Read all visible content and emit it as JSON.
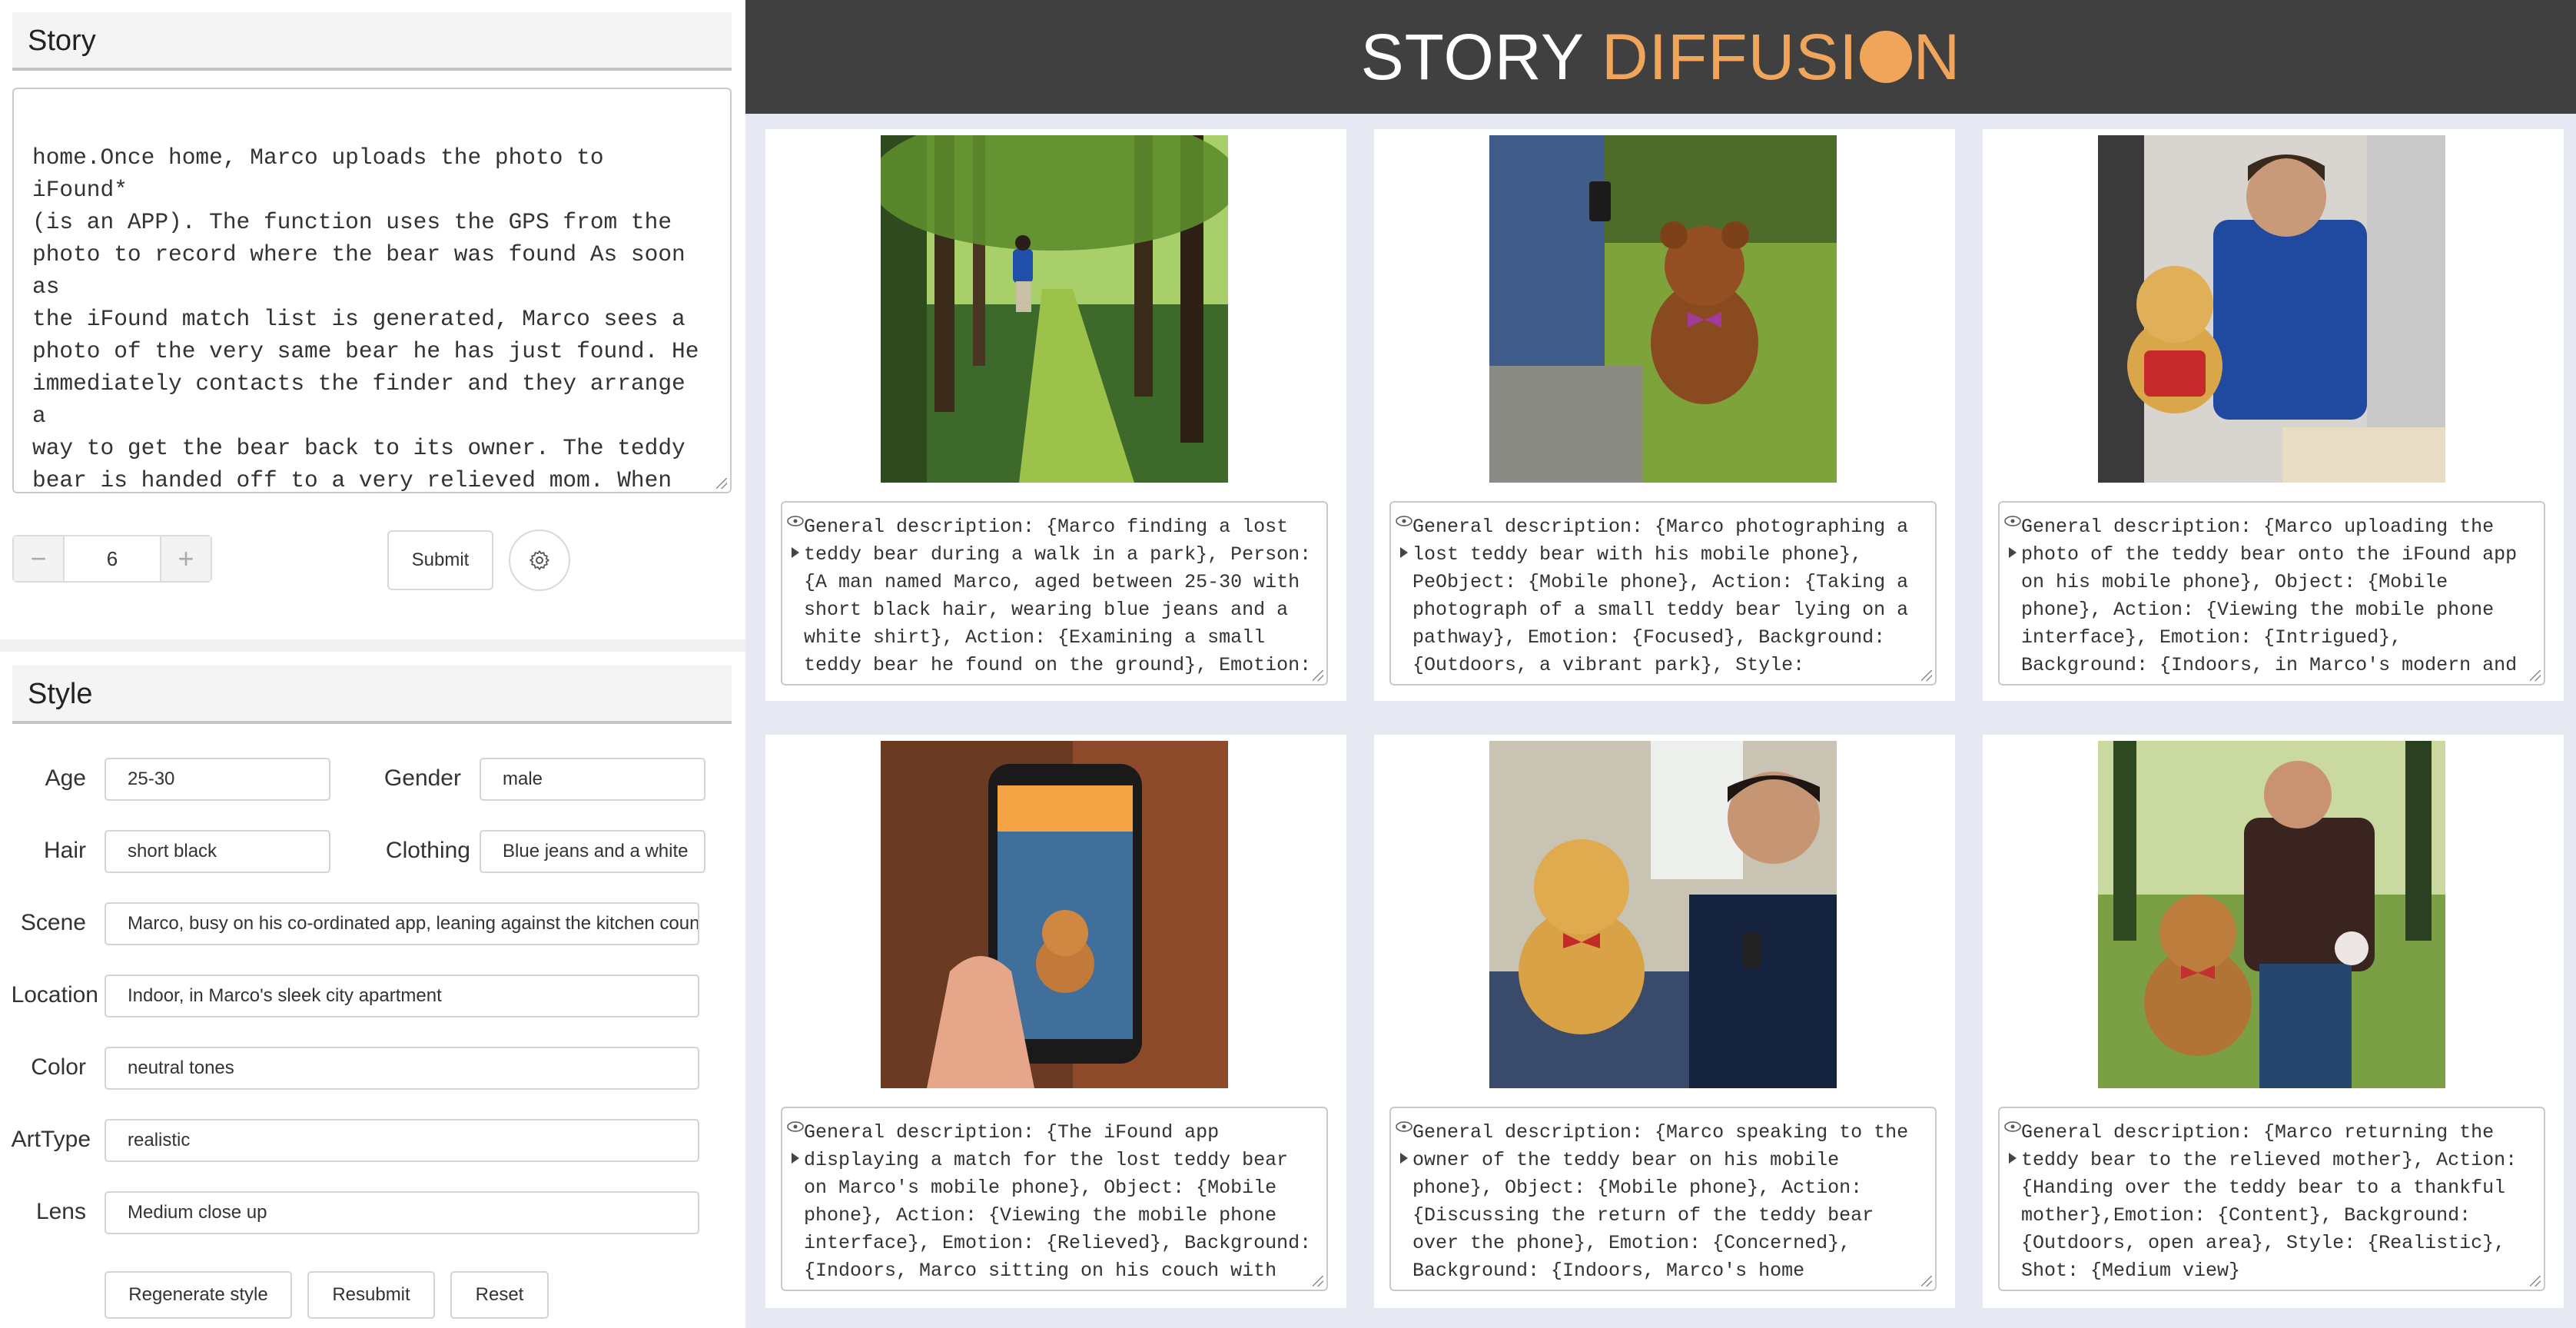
{
  "story": {
    "title": "Story",
    "text": "home.Once home, Marco uploads the photo to iFound*\n(is an APP). The function uses the GPS from the\nphoto to record where the bear was found As soon as\nthe iFound match list is generated, Marco sees a\nphoto of the very same bear he has just found. He\nimmediately contacts the finder and they arrange a\nway to get the bear back to its owner. The teddy\nbear is handed off to a very relieved mom. When it\nis recorded that the bear has made it safely home,\nMarco receives a 'thank you' email from  iFound*,\noffering him a choice of coupons for anything form\nice cream to flowers. Marco's choice provides\nuseful information to corporate sponsors",
    "count_minus": "−",
    "count_value": "6",
    "count_plus": "+",
    "submit_label": "Submit",
    "settings_icon": "gear-icon"
  },
  "style": {
    "title": "Style",
    "age_label": "Age",
    "age_value": "25-30",
    "gender_label": "Gender",
    "gender_value": "male",
    "hair_label": "Hair",
    "hair_value": "short black",
    "clothing_label": "Clothing",
    "clothing_value": "Blue jeans and a white",
    "scene_label": "Scene",
    "scene_value": "Marco, busy on his co-ordinated app, leaning against the kitchen counter",
    "location_label": "Location",
    "location_value": "Indoor, in Marco's sleek city apartment",
    "color_label": "Color",
    "color_value": "neutral tones",
    "arttype_label": "ArtType",
    "arttype_value": "realistic",
    "lens_label": "Lens",
    "lens_value": "Medium close up",
    "regenerate_label": "Regenerate style",
    "resubmit_label": "Resubmit",
    "reset_label": "Reset"
  },
  "banner": {
    "word1": "STORY",
    "word2a": "DIFFUSI",
    "word2b": "N"
  },
  "panels": [
    {
      "desc": "General description: {Marco finding a lost teddy bear during a walk in a park}, Person: {A man named Marco, aged between 25-30 with short black hair, wearing blue jeans and a white shirt}, Action: {Examining a small teddy bear he found on the ground}, Emotion:"
    },
    {
      "desc": "General description: {Marco photographing a lost teddy bear with his mobile phone}, PeObject: {Mobile phone}, Action: {Taking a photograph of a small teddy bear lying on a pathway}, Emotion: {Focused}, Background: {Outdoors, a vibrant park}, Style:"
    },
    {
      "desc": "General description: {Marco uploading the photo of the teddy bear onto the iFound app on his mobile phone}, Object: {Mobile phone}, Action: {Viewing the mobile phone interface}, Emotion: {Intrigued}, Background: {Indoors, in Marco's modern and minimalistic loft},"
    },
    {
      "desc": "General description: {The iFound app displaying a match for the lost teddy bear on Marco's mobile phone}, Object: {Mobile phone}, Action: {Viewing the mobile phone interface}, Emotion: {Relieved}, Background: {Indoors, Marco sitting on his couch with his"
    },
    {
      "desc": "General description: {Marco speaking to the owner of the teddy bear on his mobile phone}, Object: {Mobile phone}, Action: {Discussing the return of the teddy bear over the phone}, Emotion: {Concerned}, Background: {Indoors, Marco's home interior}, Style: {Realistic},"
    },
    {
      "desc": "General description: {Marco returning the teddy bear to the relieved mother}, Action: {Handing over the teddy bear to a thankful mother},Emotion: {Content}, Background: {Outdoors, open area}, Style: {Realistic}, Shot: {Medium view}"
    }
  ],
  "colors": {
    "banner_bg": "#404040",
    "accent": "#f0a55a",
    "gallery_bg": "#e6e9f2"
  }
}
